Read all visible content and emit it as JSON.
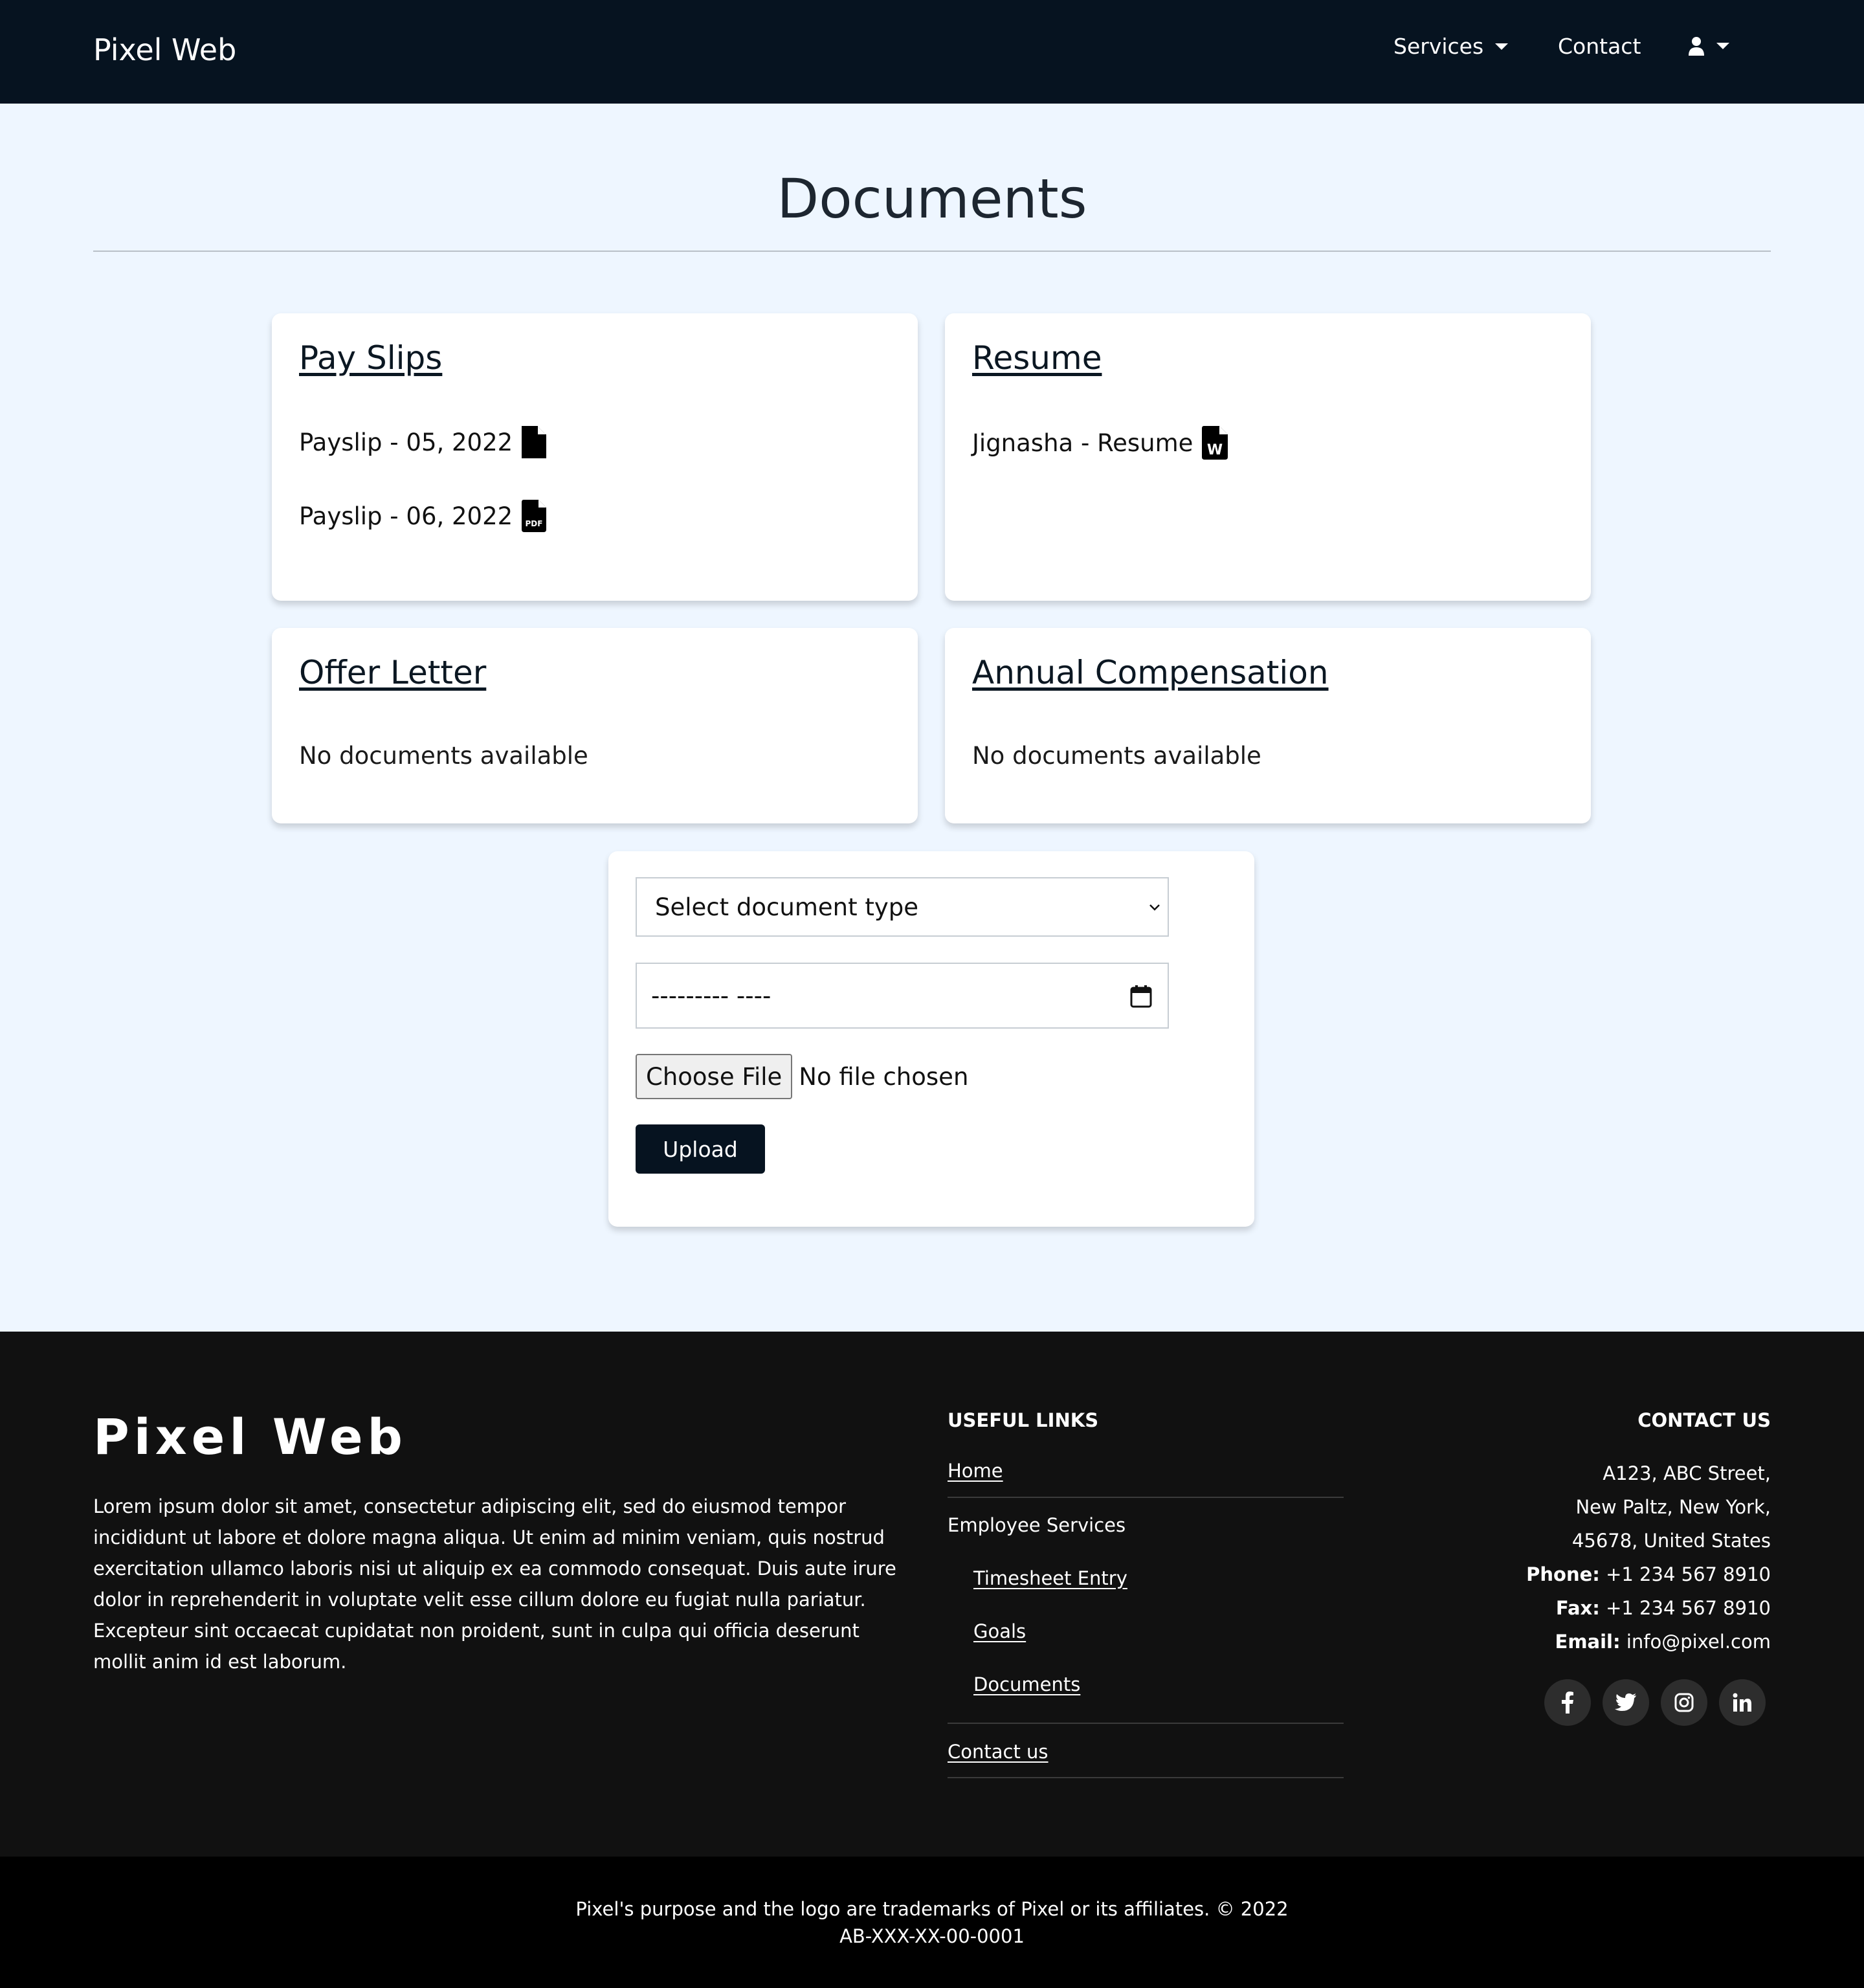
{
  "navbar": {
    "brand": "Pixel Web",
    "services_label": "Services",
    "contact_label": "Contact",
    "user_icon": "user-icon"
  },
  "page": {
    "title": "Documents"
  },
  "cards": {
    "payslips": {
      "title": "Pay Slips",
      "items": [
        {
          "label": "Payslip - 05, 2022",
          "icon": "file-icon"
        },
        {
          "label": "Payslip - 06, 2022",
          "icon": "pdf-file-icon"
        }
      ]
    },
    "resume": {
      "title": "Resume",
      "items": [
        {
          "label": "Jignasha - Resume",
          "icon": "word-file-icon"
        }
      ]
    },
    "offer_letter": {
      "title": "Offer Letter",
      "empty_text": "No documents available"
    },
    "annual_comp": {
      "title": "Annual Compensation",
      "empty_text": "No documents available"
    }
  },
  "upload_form": {
    "select_placeholder": "Select document type",
    "date_placeholder": "--------- ----",
    "choose_file_label": "Choose File",
    "file_status": "No file chosen",
    "upload_label": "Upload"
  },
  "footer": {
    "brand": "Pixel Web",
    "description": "Lorem ipsum dolor sit amet, consectetur adipiscing elit, sed do eiusmod tempor incididunt ut labore et dolore magna aliqua. Ut enim ad minim veniam, quis nostrud exercitation ullamco laboris nisi ut aliquip ex ea commodo consequat. Duis aute irure dolor in reprehenderit in voluptate velit esse cillum dolore eu fugiat nulla pariatur. Excepteur sint occaecat cupidatat non proident, sunt in culpa qui officia deserunt mollit anim id est laborum.",
    "useful_links": {
      "heading": "USEFUL LINKS",
      "home": "Home",
      "employee_services": "Employee Services",
      "timesheet": "Timesheet Entry",
      "goals": "Goals",
      "documents": "Documents",
      "contact_us": "Contact us"
    },
    "contact": {
      "heading": "CONTACT US",
      "address_line1": "A123, ABC Street,",
      "address_line2": "New Paltz, New York,",
      "address_line3": "45678, United States",
      "phone_label": "Phone:",
      "phone": "+1 234 567 8910",
      "fax_label": "Fax:",
      "fax": "+1 234 567 8910",
      "email_label": "Email:",
      "email": "info@pixel.com"
    },
    "social_icons": [
      "facebook-icon",
      "twitter-icon",
      "instagram-icon",
      "linkedin-icon"
    ],
    "copyright": "Pixel's purpose and the logo are trademarks of Pixel or its affiliates. © 2022",
    "code": "AB-XXX-XX-00-0001"
  },
  "colors": {
    "navbar_bg": "#061320",
    "page_bg": "#eef6ff",
    "footer_bg": "#111111",
    "bottom_bar_bg": "#000000",
    "button_bg": "#061320"
  }
}
